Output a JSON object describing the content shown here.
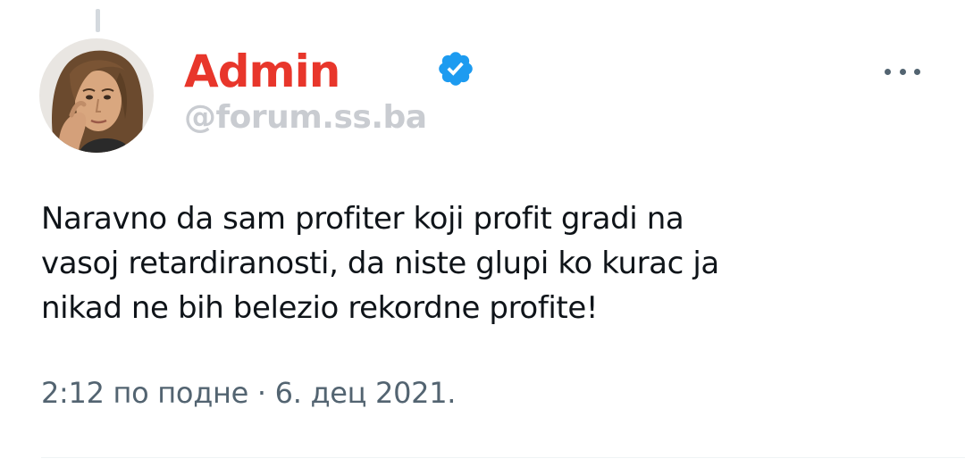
{
  "author": {
    "display_name": "Admin",
    "handle": "@forum.ss.ba",
    "verified": true,
    "name_color": "#e8362b",
    "avatar_icon": "profile-photo"
  },
  "tweet": {
    "text_lines": [
      "Naravno da sam profiter koji profit gradi na",
      "vasoj retardiranosti, da niste glupi ko kurac ja",
      "nikad ne bih belezio rekordne profite!"
    ],
    "timestamp": "2:12 по подне · 6. дец 2021."
  },
  "icons": {
    "verified": "verified-badge-icon",
    "more": "more-options-icon"
  },
  "colors": {
    "verified_blue": "#1d9bf0",
    "muted_text": "#536471"
  }
}
